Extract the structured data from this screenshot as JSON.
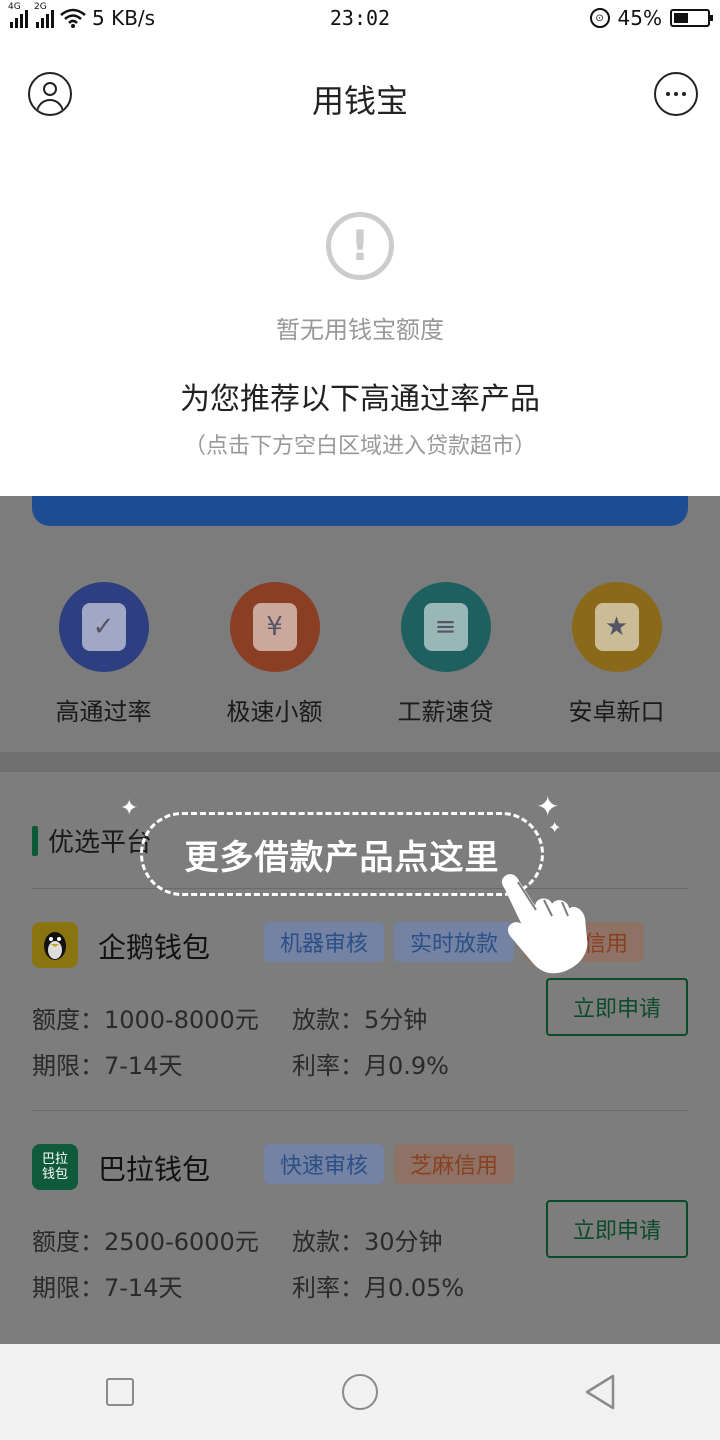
{
  "status_bar": {
    "network1": "4G",
    "network2": "2G",
    "speed": "5 KB/s",
    "time": "23:02",
    "battery_text": "45%",
    "battery_level": 0.45
  },
  "header": {
    "title": "用钱宝"
  },
  "notice": {
    "no_quota": "暂无用钱宝额度",
    "recommend": "为您推荐以下高通过率产品",
    "hint": "（点击下方空白区域进入贷款超市）"
  },
  "categories": [
    {
      "label": "高通过率",
      "icon": "shield-check-icon",
      "color": "#2d3f80"
    },
    {
      "label": "极速小额",
      "icon": "money-bag-icon",
      "color": "#8a3e24"
    },
    {
      "label": "工薪速贷",
      "icon": "receipt-lightning-icon",
      "color": "#1e6060"
    },
    {
      "label": "安卓新口",
      "icon": "star-bookmark-icon",
      "color": "#8a6a1a"
    }
  ],
  "section": {
    "title": "优选平台"
  },
  "callout": {
    "text": "更多借款产品点这里"
  },
  "products": [
    {
      "name": "企鹅钱包",
      "logo_icon": "penguin-icon",
      "logo_color": "#8a7410",
      "tags": [
        {
          "text": "机器审核",
          "style": "blue"
        },
        {
          "text": "实时放款",
          "style": "blue"
        },
        {
          "text": "芝麻信用",
          "style": "orange"
        }
      ],
      "amount": "额度：1000-8000元",
      "payout": "放款：5分钟",
      "term": "期限：7-14天",
      "rate": "利率：月0.9%",
      "apply": "立即申请"
    },
    {
      "name": "巴拉钱包",
      "logo_text": "巴拉钱包",
      "logo_color": "#0e5a3a",
      "tags": [
        {
          "text": "快速审核",
          "style": "blue"
        },
        {
          "text": "芝麻信用",
          "style": "orange"
        }
      ],
      "amount": "额度：2500-6000元",
      "payout": "放款：30分钟",
      "term": "期限：7-14天",
      "rate": "利率：月0.05%",
      "apply": "立即申请"
    }
  ],
  "navbar": {
    "recent": "recent-apps-icon",
    "home": "home-icon",
    "back": "back-icon"
  }
}
